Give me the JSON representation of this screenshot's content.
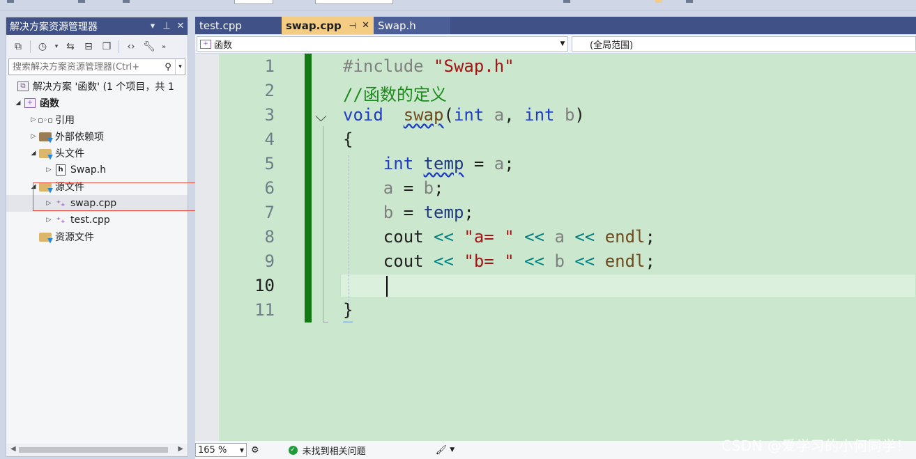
{
  "solution_explorer": {
    "title": "解决方案资源管理器",
    "search_placeholder": "搜索解决方案资源管理器(Ctrl+",
    "tree": {
      "solution": "解决方案 '函数' (1 个项目，共 1",
      "project": "函数",
      "references": "引用",
      "external_deps": "外部依赖项",
      "header_files": "头文件",
      "swap_h": "Swap.h",
      "source_files": "源文件",
      "swap_cpp": "swap.cpp",
      "test_cpp": "test.cpp",
      "resource_files": "资源文件"
    }
  },
  "editor": {
    "tabs": [
      {
        "label": "test.cpp"
      },
      {
        "label": "swap.cpp"
      },
      {
        "label": "Swap.h"
      }
    ],
    "nav_scope": "函数",
    "nav_global": "(全局范围)",
    "line_numbers": [
      "1",
      "2",
      "3",
      "4",
      "5",
      "6",
      "7",
      "8",
      "9",
      "10",
      "11"
    ],
    "current_line": 10
  },
  "code": {
    "l1_directive": "#include",
    "l1_str": "\"Swap.h\"",
    "l2_comment": "//函数的定义",
    "l3_void": "void",
    "l3_fn": "swap",
    "l3_paren_open": "(",
    "l3_int1": "int",
    "l3_a": "a",
    "l3_comma": ", ",
    "l3_int2": "int",
    "l3_b": "b",
    "l3_paren_close": ")",
    "l4_brace": "{",
    "l5_int": "int",
    "l5_temp": "temp",
    "l5_eq": " = ",
    "l5_a": "a",
    "l5_semi": ";",
    "l6_a": "a",
    "l6_eq": " = ",
    "l6_b": "b",
    "l6_semi": ";",
    "l7_b": "b",
    "l7_eq": " = ",
    "l7_temp": "temp",
    "l7_semi": ";",
    "l8_cout": "cout",
    "l8_op1": " << ",
    "l8_str": "\"a= \"",
    "l8_op2": " << ",
    "l8_a": "a",
    "l8_op3": " << ",
    "l8_endl": "endl",
    "l8_semi": ";",
    "l9_cout": "cout",
    "l9_op1": " << ",
    "l9_str": "\"b= \"",
    "l9_op2": " << ",
    "l9_b": "b",
    "l9_op3": " << ",
    "l9_endl": "endl",
    "l9_semi": ";",
    "l11_brace": "}"
  },
  "status_bar": {
    "zoom": "165 %",
    "issues": "未找到相关问题"
  },
  "watermark": "CSDN @爱学习的小何同学！"
}
